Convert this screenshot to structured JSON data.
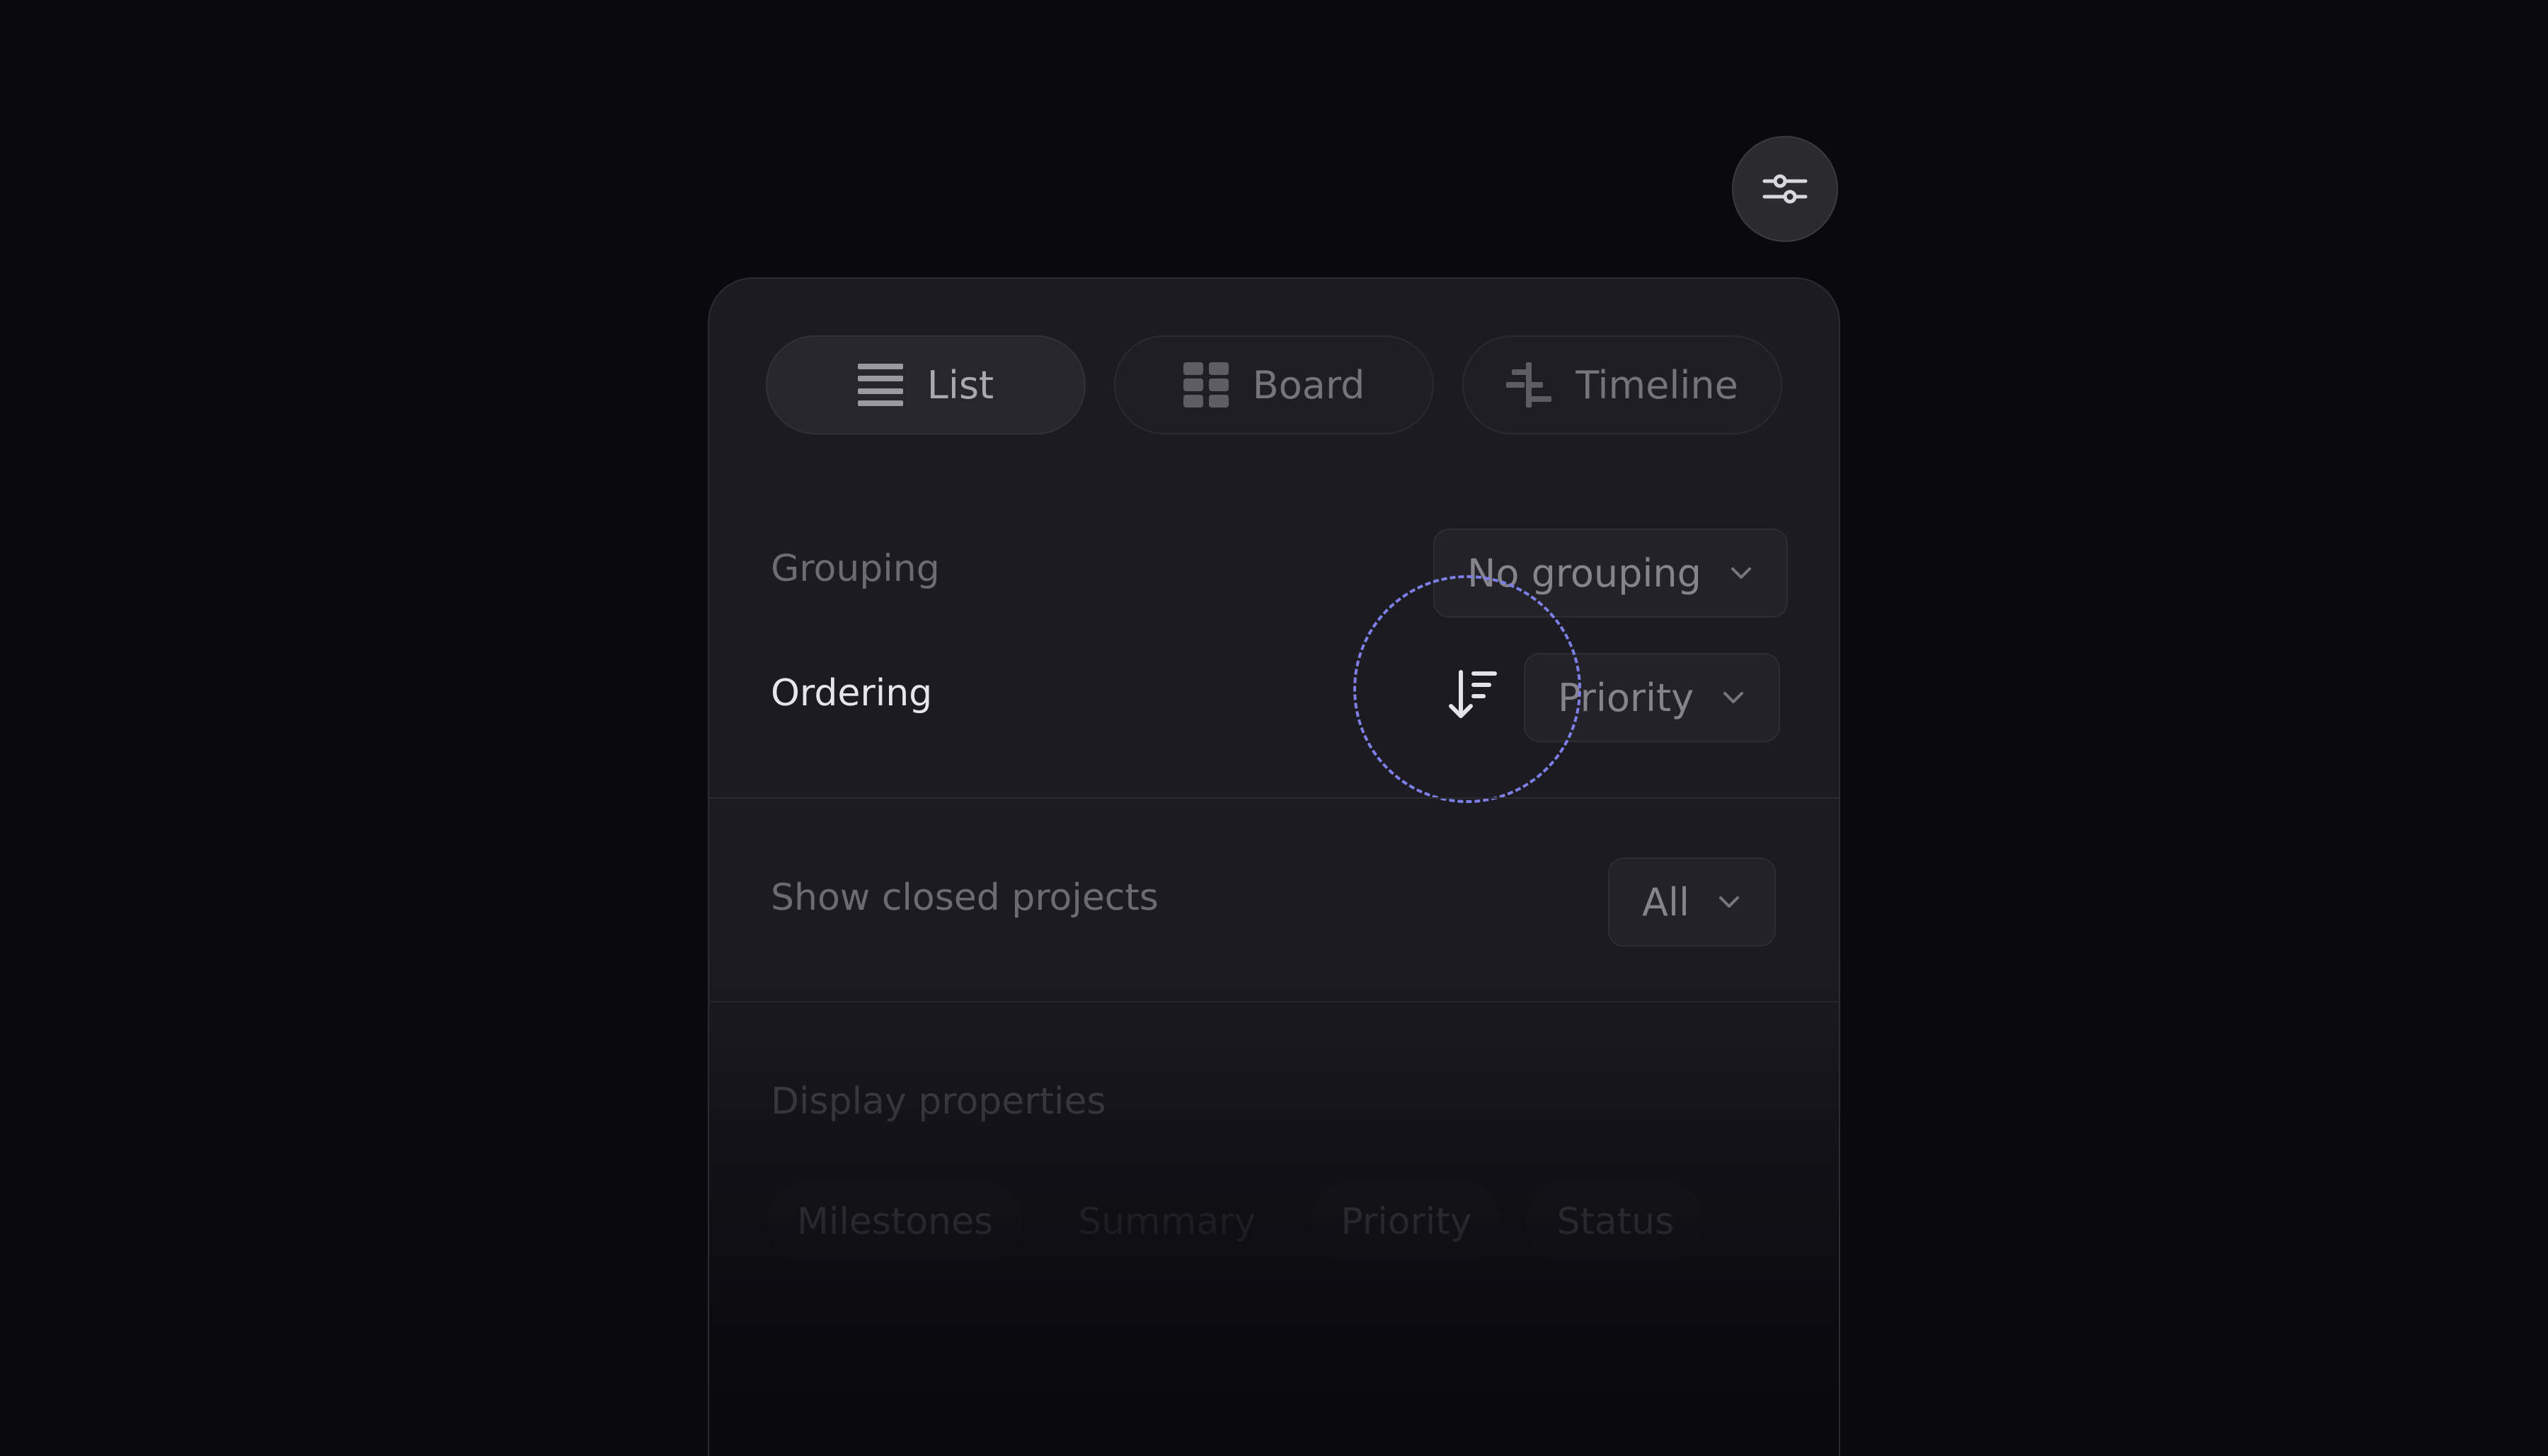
{
  "display_button": {
    "icon": "sliders-icon"
  },
  "view_tabs": [
    {
      "label": "List",
      "icon": "list-icon",
      "active": true
    },
    {
      "label": "Board",
      "icon": "board-grid-icon",
      "active": false
    },
    {
      "label": "Timeline",
      "icon": "timeline-icon",
      "active": false
    }
  ],
  "grouping": {
    "label": "Grouping",
    "value": "No grouping"
  },
  "ordering": {
    "label": "Ordering",
    "value": "Priority",
    "direction_icon": "sort-descending-icon"
  },
  "closed_projects": {
    "label": "Show closed projects",
    "value": "All"
  },
  "display_properties": {
    "title": "Display properties",
    "chips": [
      {
        "label": "Milestones",
        "enabled": true
      },
      {
        "label": "Summary",
        "enabled": false
      },
      {
        "label": "Priority",
        "enabled": true
      },
      {
        "label": "Status",
        "enabled": true
      }
    ]
  },
  "colors": {
    "background": "#09090e",
    "panel": "#1c1b21",
    "focus_ring": "#7d7fe6"
  }
}
